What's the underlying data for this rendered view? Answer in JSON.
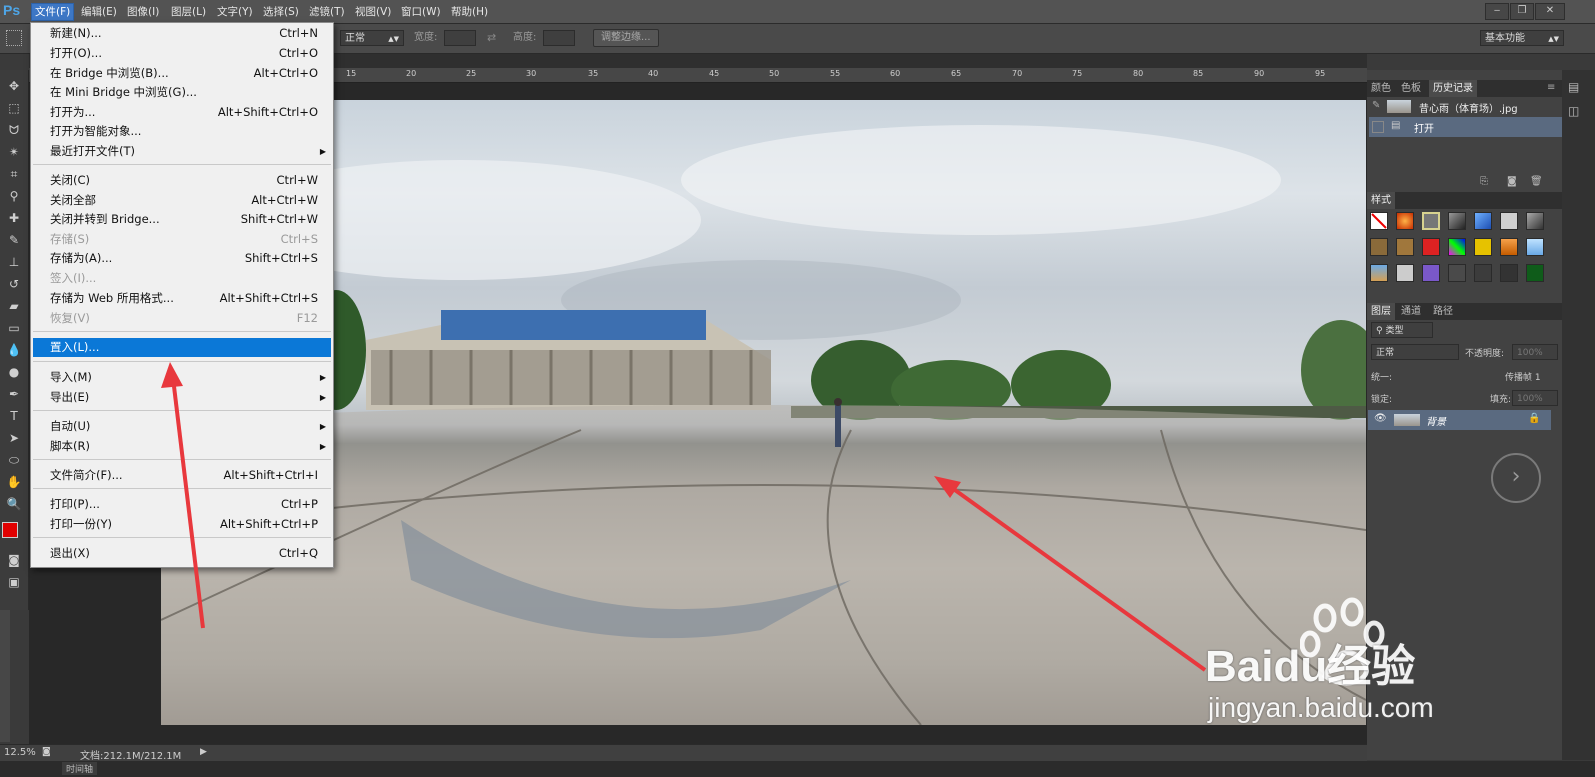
{
  "app": {
    "logo": "Ps"
  },
  "menubar": {
    "items": [
      "文件(F)",
      "编辑(E)",
      "图像(I)",
      "图层(L)",
      "文字(Y)",
      "选择(S)",
      "滤镜(T)",
      "视图(V)",
      "窗口(W)",
      "帮助(H)"
    ],
    "window_buttons": [
      "‒",
      "❐",
      "✕"
    ]
  },
  "options": {
    "style_value": "正常",
    "width_label": "宽度:",
    "height_label": "高度:",
    "refine_edge": "调整边缘...",
    "workspace": "基本功能"
  },
  "ruler": {
    "ticks": [
      "15",
      "20",
      "25",
      "30",
      "35",
      "40",
      "45",
      "50",
      "55",
      "60",
      "65",
      "70",
      "75",
      "80",
      "85",
      "90",
      "95"
    ]
  },
  "file_menu": {
    "items": [
      {
        "label": "新建(N)...",
        "shortcut": "Ctrl+N"
      },
      {
        "label": "打开(O)...",
        "shortcut": "Ctrl+O"
      },
      {
        "label": "在 Bridge 中浏览(B)...",
        "shortcut": "Alt+Ctrl+O"
      },
      {
        "label": "在 Mini Bridge 中浏览(G)...",
        "shortcut": ""
      },
      {
        "label": "打开为...",
        "shortcut": "Alt+Shift+Ctrl+O"
      },
      {
        "label": "打开为智能对象...",
        "shortcut": ""
      },
      {
        "label": "最近打开文件(T)",
        "shortcut": "",
        "submenu": true
      },
      {
        "label": "关闭(C)",
        "shortcut": "Ctrl+W"
      },
      {
        "label": "关闭全部",
        "shortcut": "Alt+Ctrl+W"
      },
      {
        "label": "关闭并转到 Bridge...",
        "shortcut": "Shift+Ctrl+W"
      },
      {
        "label": "存储(S)",
        "shortcut": "Ctrl+S",
        "disabled": true
      },
      {
        "label": "存储为(A)...",
        "shortcut": "Shift+Ctrl+S"
      },
      {
        "label": "签入(I)...",
        "shortcut": "",
        "disabled": true
      },
      {
        "label": "存储为 Web 所用格式...",
        "shortcut": "Alt+Shift+Ctrl+S"
      },
      {
        "label": "恢复(V)",
        "shortcut": "F12",
        "disabled": true
      },
      {
        "label": "置入(L)...",
        "shortcut": "",
        "highlighted": true
      },
      {
        "label": "导入(M)",
        "shortcut": "",
        "submenu": true
      },
      {
        "label": "导出(E)",
        "shortcut": "",
        "submenu": true
      },
      {
        "label": "自动(U)",
        "shortcut": "",
        "submenu": true
      },
      {
        "label": "脚本(R)",
        "shortcut": "",
        "submenu": true
      },
      {
        "label": "文件简介(F)...",
        "shortcut": "Alt+Shift+Ctrl+I"
      },
      {
        "label": "打印(P)...",
        "shortcut": "Ctrl+P"
      },
      {
        "label": "打印一份(Y)",
        "shortcut": "Alt+Shift+Ctrl+P"
      },
      {
        "label": "退出(X)",
        "shortcut": "Ctrl+Q"
      }
    ]
  },
  "history_panel": {
    "tabs": [
      "颜色",
      "色板",
      "历史记录"
    ],
    "snapshot": "昔心雨（体育场）.jpg",
    "states": [
      "打开"
    ]
  },
  "styles_panel": {
    "title": "样式"
  },
  "layers_panel": {
    "tabs": [
      "图层",
      "通道",
      "路径"
    ],
    "filter": "类型",
    "blend_mode": "正常",
    "opacity_label": "不透明度:",
    "opacity_value": "100%",
    "unify_label": "统一:",
    "propagate_label": "传播帧 1",
    "lock_label": "锁定:",
    "fill_label": "填充:",
    "fill_value": "100%",
    "layer_name": "背景"
  },
  "status": {
    "zoom": "12.5%",
    "doc": "文档:212.1M/212.1M"
  },
  "bottom": {
    "tab": "时间轴"
  },
  "watermark": {
    "brand": "Baidu经验",
    "url": "jingyan.baidu.com"
  },
  "colors": {
    "accent": "#0b78d7",
    "arrow": "#e8383d",
    "fg": "#e00000",
    "bg": "#ffffff"
  }
}
